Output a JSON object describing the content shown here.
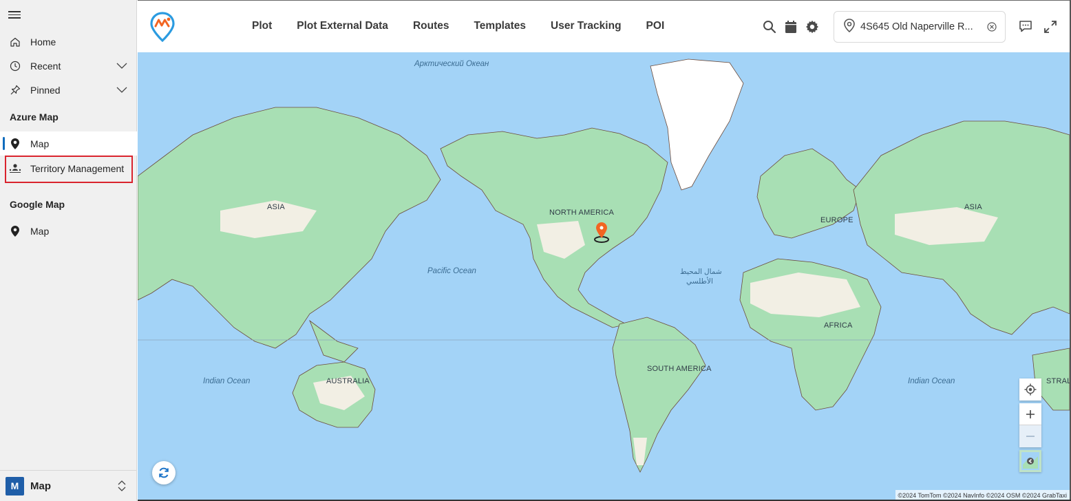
{
  "sidebar": {
    "home": "Home",
    "recent": "Recent",
    "pinned": "Pinned",
    "section_azure": "Azure Map",
    "azure_map": "Map",
    "territory": "Territory Management",
    "section_google": "Google Map",
    "google_map": "Map",
    "footer_avatar": "M",
    "footer_label": "Map"
  },
  "header": {
    "nav": [
      "Plot",
      "Plot External Data",
      "Routes",
      "Templates",
      "User Tracking",
      "POI"
    ],
    "search_value": "4S645 Old Naperville R..."
  },
  "map": {
    "labels": {
      "arctic": "Арктический Океан",
      "asia_left": "ASIA",
      "north_america": "NORTH AMERICA",
      "europe": "EUROPE",
      "asia_right": "ASIA",
      "pacific": "Pacific Ocean",
      "atlantic_1": "شمال المحيط",
      "atlantic_2": "الأطلسي",
      "africa": "AFRICA",
      "south_america": "SOUTH AMERICA",
      "australia": "AUSTRALIA",
      "indian_left": "Indian Ocean",
      "indian_right": "Indian Ocean",
      "stralia": "STRALIA"
    },
    "attribution": "©2024 TomTom  ©2024 NavInfo  ©2024 OSM  ©2024 GrabTaxi"
  },
  "colors": {
    "accent": "#0f6cbd",
    "highlight": "#d9232d",
    "water": "#a3d3f7",
    "land": "#a8dfb4",
    "dry_land": "#f2efe4",
    "pin": "#f26522"
  }
}
